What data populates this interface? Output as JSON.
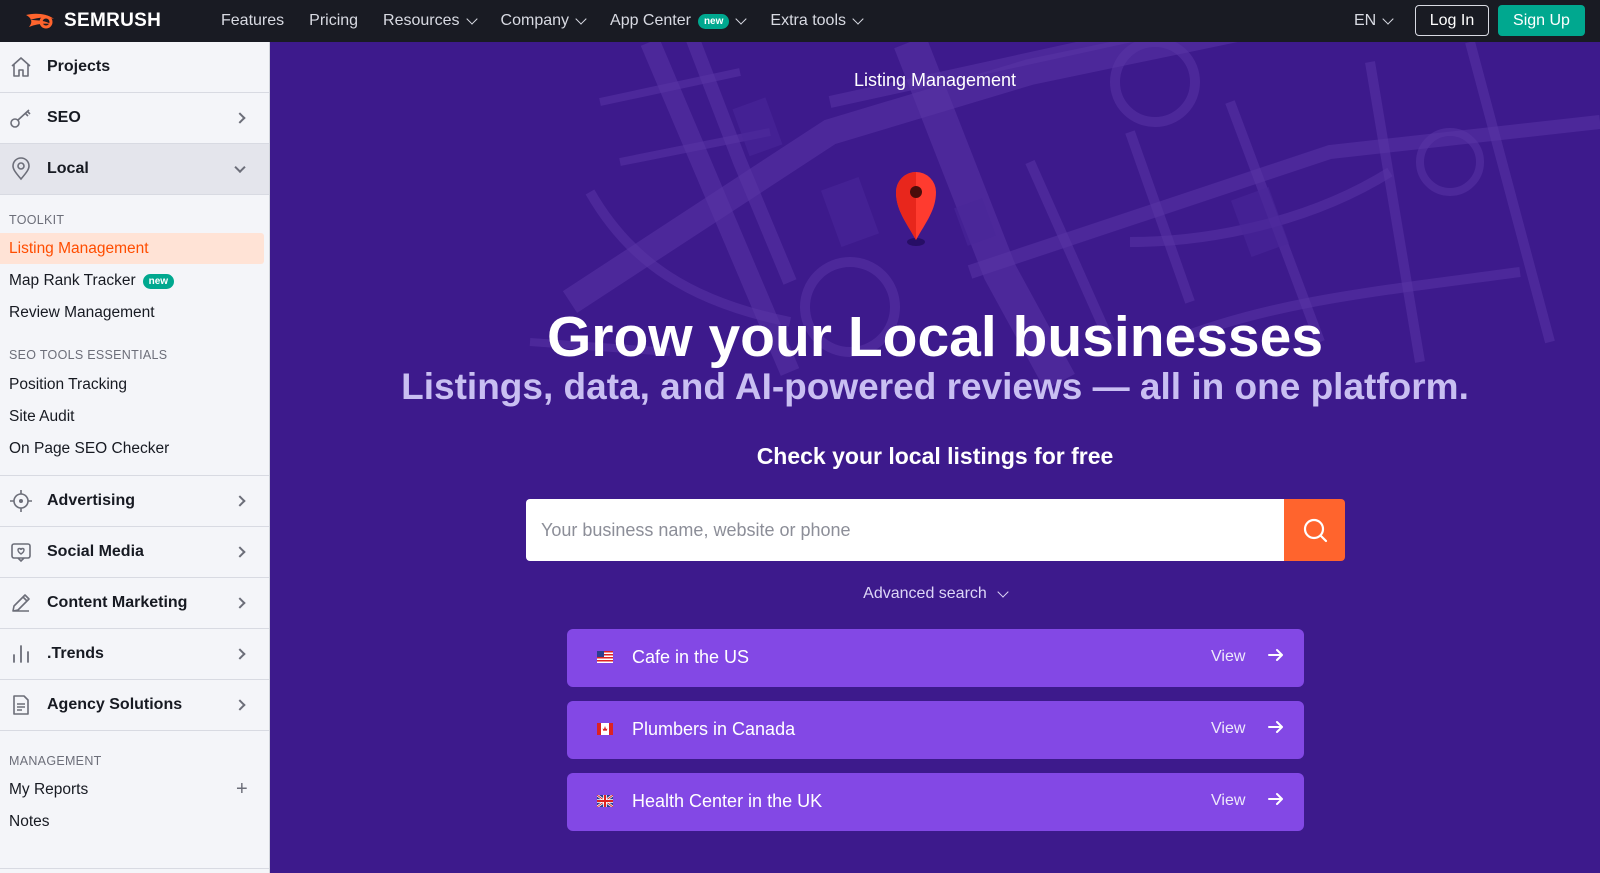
{
  "topnav": {
    "logo_text": "SEMRUSH",
    "items": [
      {
        "label": "Features"
      },
      {
        "label": "Pricing"
      },
      {
        "label": "Resources"
      },
      {
        "label": "Company"
      },
      {
        "label": "App Center",
        "badge": "new"
      },
      {
        "label": "Extra tools"
      }
    ],
    "language": "EN",
    "login_label": "Log In",
    "signup_label": "Sign Up"
  },
  "sidebar": {
    "projects": "Projects",
    "seo": "SEO",
    "local": "Local",
    "toolkit_heading": "TOOLKIT",
    "toolkit": [
      {
        "label": "Listing Management",
        "active": true
      },
      {
        "label": "Map Rank Tracker",
        "badge": "new"
      },
      {
        "label": "Review Management"
      }
    ],
    "essentials_heading": "SEO TOOLS ESSENTIALS",
    "essentials": [
      {
        "label": "Position Tracking"
      },
      {
        "label": "Site Audit"
      },
      {
        "label": "On Page SEO Checker"
      }
    ],
    "sections": [
      {
        "label": "Advertising",
        "icon": "target-icon"
      },
      {
        "label": "Social Media",
        "icon": "chat-bubble-icon"
      },
      {
        "label": "Content Marketing",
        "icon": "pencil-icon"
      },
      {
        "label": ".Trends",
        "icon": "bar-chart-icon"
      },
      {
        "label": "Agency Solutions",
        "icon": "document-icon"
      }
    ],
    "management_heading": "MANAGEMENT",
    "management": [
      {
        "label": "My Reports"
      },
      {
        "label": "Notes"
      }
    ]
  },
  "hero": {
    "tag": "Listing Management",
    "title": "Grow your Local businesses",
    "subtitle": "Listings, data, and AI-powered reviews — all in one platform.",
    "check_label": "Check your local listings for free",
    "search_placeholder": "Your business name, website or phone",
    "advanced_search": "Advanced search",
    "examples": [
      {
        "label": "Cafe in the US",
        "flag": "us-flag-icon",
        "view": "View"
      },
      {
        "label": "Plumbers in Canada",
        "flag": "canada-flag-icon",
        "view": "View"
      },
      {
        "label": "Health Center in the UK",
        "flag": "uk-flag-icon",
        "view": "View"
      }
    ]
  },
  "colors": {
    "nav_bg": "#191b23",
    "hero_bg": "#3d1a8c",
    "accent_orange": "#ff642d",
    "signup_green": "#00a88f",
    "example_card": "#8348e5",
    "pin_red": "#ff3b2f"
  }
}
